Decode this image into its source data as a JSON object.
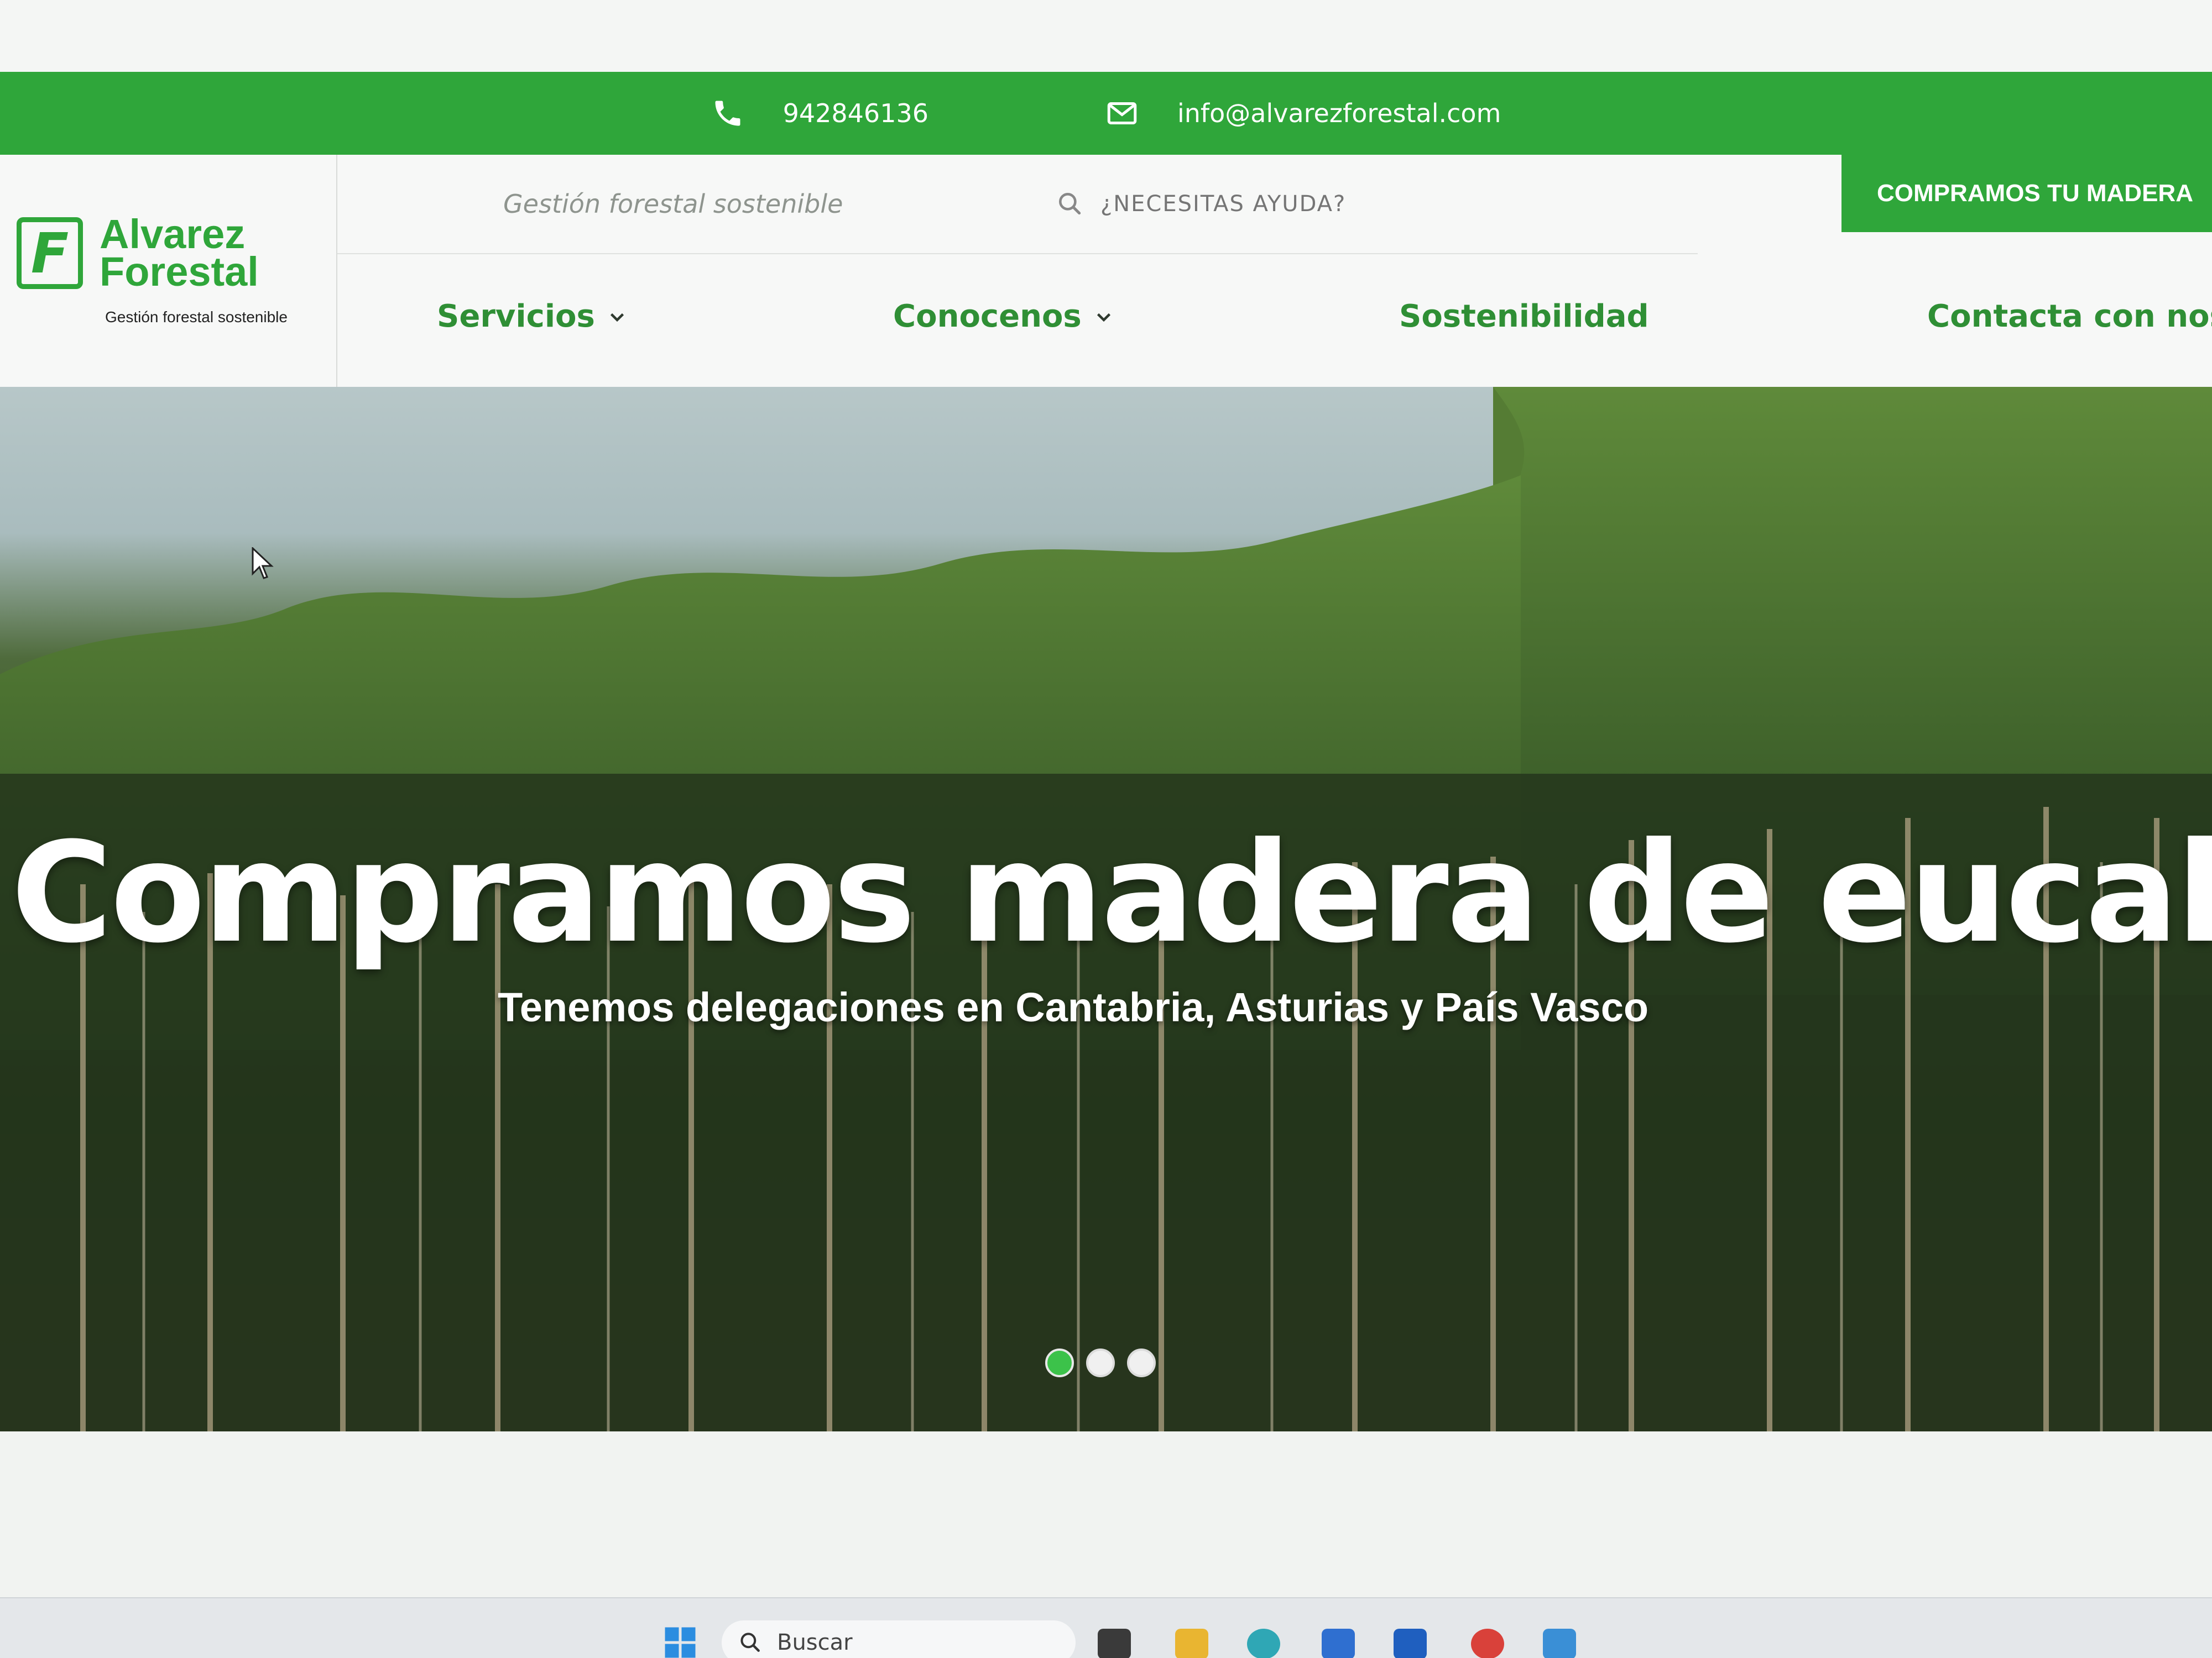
{
  "topbar": {
    "phone": "942846136",
    "email": "info@alvarezforestal.com",
    "phone_icon": "phone-icon",
    "email_icon": "envelope-icon"
  },
  "logo": {
    "mark": "F",
    "name_line1": "Alvarez",
    "name_line2": "Forestal",
    "tagline": "Gestión forestal sostenible"
  },
  "header": {
    "tagline_text": "Gestión forestal sostenible",
    "search_placeholder": "¿NECESITAS AYUDA?",
    "cta_label": "COMPRAMOS TU MADERA"
  },
  "nav": {
    "items": [
      {
        "label": "Servicios",
        "has_dropdown": true
      },
      {
        "label": "Conocenos",
        "has_dropdown": true
      },
      {
        "label": "Sostenibilidad",
        "has_dropdown": false
      },
      {
        "label": "Contacta con nos",
        "has_dropdown": false
      }
    ]
  },
  "hero": {
    "title": "Compramos madera de eucalipto",
    "subtitle": "Tenemos delegaciones en Cantabria, Asturias y País Vasco",
    "slides_total": 3,
    "active_slide": 1
  },
  "taskbar": {
    "search_label": "Buscar"
  },
  "colors": {
    "brand_green": "#2fa63a",
    "nav_green": "#2f8f35"
  }
}
